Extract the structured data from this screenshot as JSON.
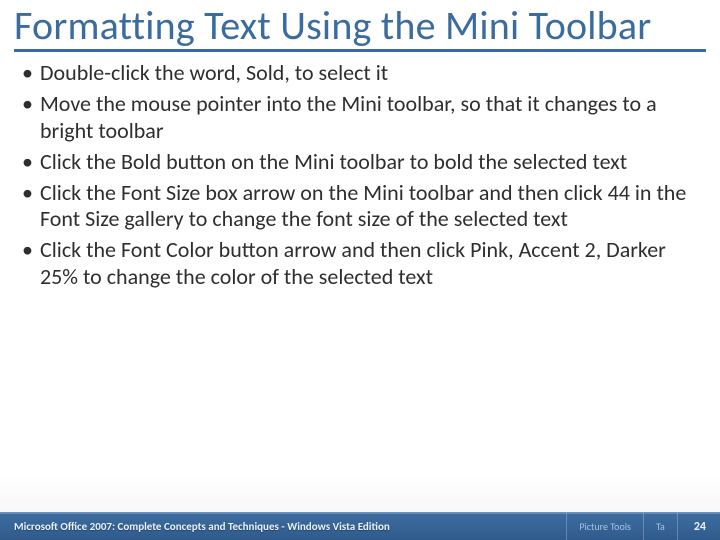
{
  "slide": {
    "title": "Formatting Text Using the Mini Toolbar",
    "bullets": [
      "Double-click the word, Sold, to select it",
      "Move the mouse pointer into the Mini toolbar, so that it changes to a bright toolbar",
      "Click the Bold button on the Mini toolbar to bold the selected text",
      "Click the Font Size box arrow on the Mini toolbar and then click 44 in the Font Size gallery to change the font size of the selected text",
      "Click the Font Color button arrow and then click Pink, Accent 2, Darker 25% to change the color of the selected text"
    ]
  },
  "footer": {
    "text": "Microsoft Office 2007: Complete Concepts and Techniques - Windows Vista Edition",
    "segments": [
      "",
      "Picture Tools",
      "Ta"
    ],
    "page": "24"
  }
}
